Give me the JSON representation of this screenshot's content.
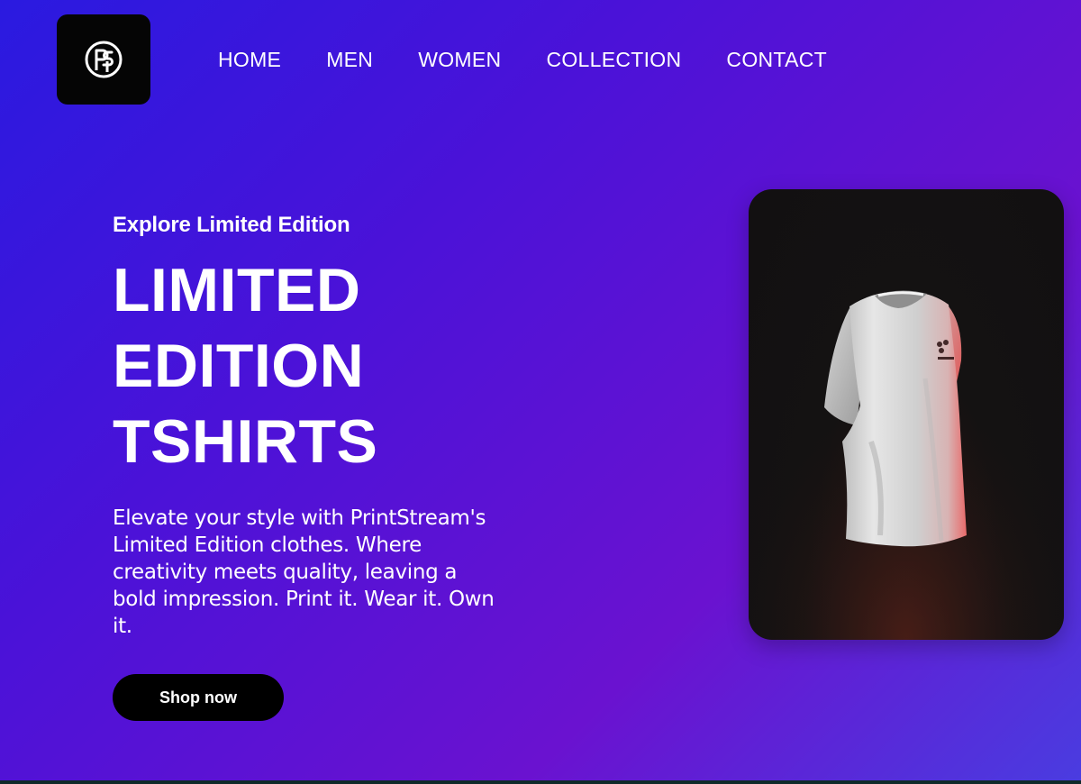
{
  "brand": {
    "logo_icon": "ps-monogram-logo"
  },
  "nav": {
    "items": [
      {
        "label": "HOME"
      },
      {
        "label": "MEN"
      },
      {
        "label": "WOMEN"
      },
      {
        "label": "COLLECTION"
      },
      {
        "label": "CONTACT"
      }
    ]
  },
  "hero": {
    "eyebrow": "Explore Limited Edition",
    "headline_lines": [
      "LIMITED",
      "EDITION",
      "TSHIRTS"
    ],
    "description": "Elevate your style with PrintStream's Limited Edition clothes. Where creativity meets quality, leaving a bold impression. Print it. Wear it. Own it.",
    "cta_label": "Shop now"
  },
  "product": {
    "image": "white-tshirt-render",
    "card_background": "#121011"
  },
  "colors": {
    "gradient_start": "#2a1ae0",
    "gradient_mid": "#6a12d0",
    "gradient_end": "#4a3ce0",
    "button_bg": "#000000",
    "text": "#ffffff"
  }
}
